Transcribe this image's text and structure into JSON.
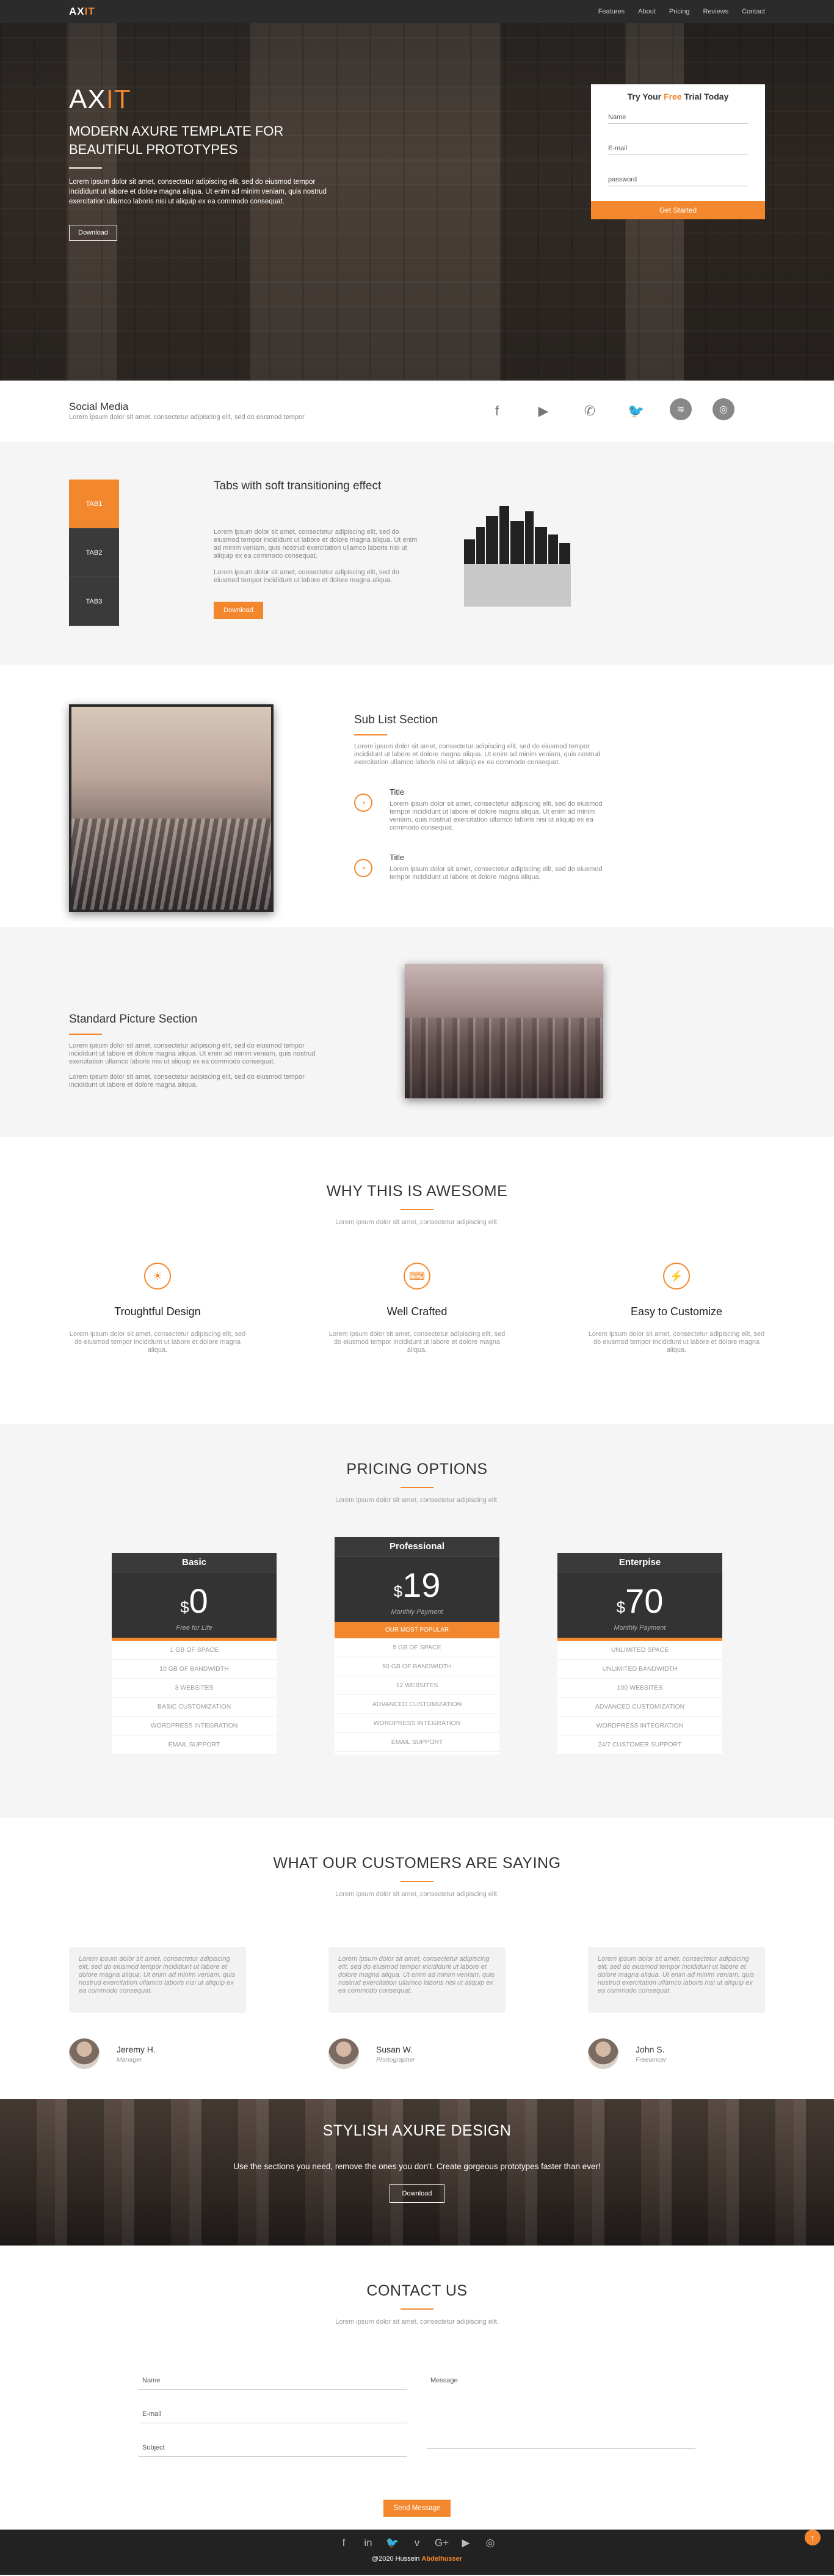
{
  "nav": {
    "logo_main": "AX",
    "logo_accent": "IT",
    "items": [
      "Features",
      "About",
      "Pricing",
      "Reviews",
      "Contact"
    ]
  },
  "hero": {
    "title_main": "AX",
    "title_accent": "IT",
    "subtitle": "MODERN AXURE TEMPLATE FOR BEAUTIFUL PROTOTYPES",
    "body": "Lorem ipsum dolor sit amet, consectetur adipiscing elit, sed do eiusmod tempor incididunt ut labore et dolore magna aliqua. Ut enim ad minim veniam, quis nostrud exercitation ullamco laboris nisi ut aliquip ex ea commodo consequat.",
    "download": "Download",
    "trial_pre": "Try Your ",
    "trial_accent": "Free",
    "trial_post": " Trial Today",
    "name": "Name",
    "email": "E-mail",
    "password": "password",
    "cta": "Get Started"
  },
  "social": {
    "title": "Social Media",
    "text": "Lorem ipsum dolor sit amet, consectetur adipiscing elit, sed do eiusmod tempor",
    "icons": [
      "facebook-icon",
      "youtube-icon",
      "whatsapp-icon",
      "twitter-icon",
      "spotify-icon",
      "instagram-icon"
    ]
  },
  "tabs": {
    "items": [
      "TAB1",
      "TAB2",
      "TAB3"
    ],
    "title": "Tabs with soft transitioning effect",
    "p1": "Lorem ipsum dolor sit amet, consectetur adipiscing elit, sed do eiusmod tempor incididunt ut labore et dolore magna aliqua. Ut enim ad minim veniam, quis nostrud exercitation ullamco laboris nisi ut aliquip ex ea commodo consequat.",
    "p2": "Lorem ipsum dolor sit amet, consectetur adipiscing elit, sed do eiusmod tempor incididunt ut labore et dolore magna aliqua.",
    "button": "Download"
  },
  "sublist": {
    "title": "Sub List Section",
    "intro": "Lorem ipsum dolor sit amet, consectetur adipiscing elit, sed do eiusmod tempor incididunt ut labore et dolore magna aliqua. Ut enim ad minim veniam, quis nostrud exercitation ullamco laboris nisi ut aliquip ex ea commodo consequat.",
    "items": [
      {
        "title": "Title",
        "text": "Lorem ipsum dolor sit amet, consectetur adipiscing elit, sed do eiusmod tempor incididunt ut labore et dolore magna aliqua. Ut enim ad minim veniam, quis nostrud exercitation ullamco laboris nisi ut aliquip ex ea commodo consequat."
      },
      {
        "title": "Title",
        "text": "Lorem ipsum dolor sit amet, consectetur adipiscing elit, sed do eiusmod tempor incididunt ut labore et dolore magna aliqua."
      }
    ]
  },
  "standard": {
    "title": "Standard Picture Section",
    "p1": "Lorem ipsum dolor sit amet, consectetur adipiscing elit, sed do eiusmod tempor incididunt ut labore et dolore magna aliqua. Ut enim ad minim veniam, quis nostrud exercitation ullamco laboris nisi ut aliquip ex ea commodo consequat.",
    "p2": "Lorem ipsum dolor sit amet, consectetur adipiscing elit, sed do eiusmod tempor incididunt ut labore et dolore magna aliqua."
  },
  "why": {
    "title": "WHY THIS IS AWESOME",
    "sub": "Lorem ipsum dolor sit amet, consectetur adipiscing elit.",
    "features": [
      {
        "icon": "lightbulb-icon",
        "glyph": "☀",
        "title": "Troughtful Design",
        "text": "Lorem ipsum dolor sit amet, consectetur adipiscing elit, sed do eiusmod tempor incididunt ut labore et dolore magna aliqua."
      },
      {
        "icon": "keyboard-icon",
        "glyph": "⌨",
        "title": "Well Crafted",
        "text": "Lorem ipsum dolor sit amet, consectetur adipiscing elit, sed do eiusmod tempor incididunt ut labore et dolore magna aliqua."
      },
      {
        "icon": "bolt-icon",
        "glyph": "⚡",
        "title": "Easy to Customize",
        "text": "Lorem ipsum dolor sit amet, consectetur adipiscing elit, sed do eiusmod tempor incididunt ut labore et dolore magna aliqua."
      }
    ]
  },
  "pricing": {
    "title": "PRICING OPTIONS",
    "sub": "Lorem ipsum dolor sit amet, consectetur adipiscing elit.",
    "plans": [
      {
        "name": "Basic",
        "currency": "$",
        "price": "0",
        "period": "Free for Life",
        "features": [
          "1 GB OF SPACE",
          "10 GB OF BANDWIDTH",
          "3 WEBSITES",
          "BASIC CUSTOMIZATION",
          "WORDPRESS INTEGRATION",
          "EMAIL SUPPORT"
        ]
      },
      {
        "name": "Professional",
        "currency": "$",
        "price": "19",
        "period": "Monthly Payment",
        "popular": "OUR MOST POPULAR",
        "features": [
          "5 GB OF SPACE",
          "50 GB OF BANDWIDTH",
          "12 WEBSITES",
          "ADVANCED CUSTOMIZATION",
          "WORDPRESS INTEGRATION",
          "EMAIL SUPPORT"
        ]
      },
      {
        "name": "Enterpise",
        "currency": "$",
        "price": "70",
        "period": "Monthly Payment",
        "features": [
          "UNLIMITED SPACE",
          "UNLIMITED BANDWIDTH",
          "100 WEBSITES",
          "ADVANCED CUSTOMIZATION",
          "WORDPRESS INTEGRATION",
          "24/7 CUSTOMER SUPPORT"
        ]
      }
    ]
  },
  "testimonials": {
    "title": "WHAT OUR CUSTOMERS ARE SAYING",
    "sub": "Lorem ipsum dolor sit amet, consectetur adipiscing elit.",
    "items": [
      {
        "quote": "Lorem ipsum dolor sit amet, consectetur adipiscing elit, sed do eiusmod tempor incididunt ut labore et dolore magna aliqua. Ut enim ad minim veniam, quis nostrud exercitation ullamco laboris nisi ut aliquip ex ea commodo consequat.",
        "name": "Jeremy H.",
        "role": "Manager"
      },
      {
        "quote": "Lorem ipsum dolor sit amet, consectetur adipiscing elit, sed do eiusmod tempor incididunt ut labore et dolore magna aliqua. Ut enim ad minim veniam, quis nostrud exercitation ullamco laboris nisi ut aliquip ex ea commodo consequat.",
        "name": "Susan W.",
        "role": "Photographer"
      },
      {
        "quote": "Lorem ipsum dolor sit amet, consectetur adipiscing elit, sed do eiusmod tempor incididunt ut labore et dolore magna aliqua. Ut enim ad minim veniam, quis nostrud exercitation ullamco laboris nisi ut aliquip ex ea commodo consequat.",
        "name": "John S.",
        "role": "Freelancer"
      }
    ]
  },
  "cta": {
    "title": "STYLISH AXURE DESIGN",
    "text": "Use the sections you need, remove the ones you don't. Create gorgeous prototypes faster than ever!",
    "button": "Download"
  },
  "contact": {
    "title": "CONTACT US",
    "sub": "Lorem ipsum dolor sit amet, consectetur adipiscing elit.",
    "name": "Name",
    "email": "E-mail",
    "subject": "Subject",
    "message": "Message",
    "send": "Send Message"
  },
  "footer": {
    "icons": [
      "facebook-icon",
      "linkedin-icon",
      "twitter-icon",
      "vimeo-icon",
      "googleplus-icon",
      "youtube-icon",
      "instagram-icon"
    ],
    "copy_pre": "@2020 Hussein ",
    "copy_accent": "Abdelhusser"
  },
  "colors": {
    "accent": "#f2872d",
    "dark": "#333333",
    "light_bg": "#f5f5f5"
  }
}
